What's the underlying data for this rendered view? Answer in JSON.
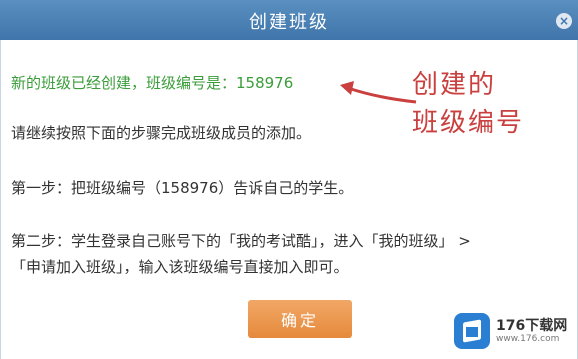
{
  "dialog": {
    "title": "创建班级",
    "close_label": "×",
    "created_msg": "新的班级已经创建，班级编号是：158976",
    "instruction": "请继续按照下面的步骤完成班级成员的添加。",
    "step1": "第一步：把班级编号（158976）告诉自己的学生。",
    "step2_line1": "第二步：学生登录自己账号下的「我的考试酷」，进入「我的班级」 >",
    "step2_line2": "「申请加入班级」，输入该班级编号直接加入即可。",
    "ok_label": "确定"
  },
  "annotation": {
    "line1": "创建的",
    "line2": "班级编号",
    "color": "#c9403f"
  },
  "watermark": {
    "brand": "176下载网",
    "url": "www.176.com"
  },
  "colors": {
    "titlebar": "#4a80b5",
    "highlight_text": "#3a9d3a",
    "button": "#e8954c"
  }
}
